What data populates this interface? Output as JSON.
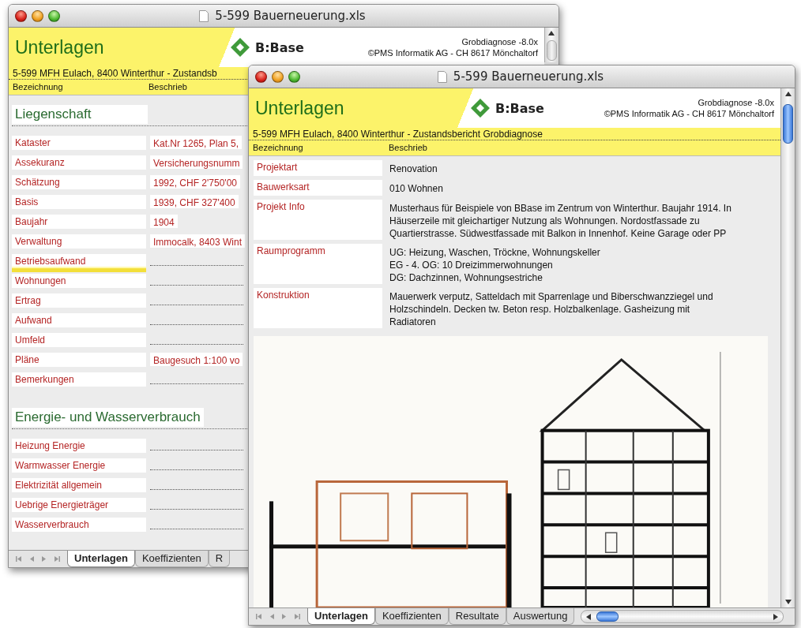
{
  "back_window": {
    "title": "5-599 Bauerneuerung.xls",
    "header": {
      "heading": "Unterlagen",
      "logo": "B:Base",
      "version": "Grobdiagnose -8.0x",
      "copyright": "©PMS Informatik AG  - CH 8617 Mönchaltorf",
      "subtitle": "5-599 MFH Eulach, 8400 Winterthur - Zustandsb"
    },
    "columns": [
      "Bezeichnung",
      "Beschrieb"
    ],
    "sections": [
      {
        "title": "Liegenschaft",
        "rows": [
          {
            "label": "Kataster",
            "value": "Kat.Nr 1265, Plan 5,",
            "highlighted": false
          },
          {
            "label": "Assekuranz",
            "value": "Versicherungsnumm",
            "highlighted": false
          },
          {
            "label": "Schätzung",
            "value": "1992, CHF 2'750'00",
            "highlighted": false
          },
          {
            "label": "Basis",
            "value": "1939, CHF 327'400",
            "highlighted": false
          },
          {
            "label": "Baujahr",
            "value": "1904",
            "highlighted": false
          },
          {
            "label": "Verwaltung",
            "value": "Immocalk, 8403 Wint",
            "highlighted": false
          },
          {
            "label": "Betriebsaufwand",
            "highlighted": true
          },
          {
            "label": "Wohnungen",
            "highlighted": false
          },
          {
            "label": "Ertrag",
            "highlighted": false
          },
          {
            "label": "Aufwand",
            "highlighted": false
          },
          {
            "label": "Umfeld",
            "highlighted": false
          },
          {
            "label": "Pläne",
            "value": "Baugesuch 1:100 vo",
            "highlighted": false
          },
          {
            "label": "Bemerkungen",
            "highlighted": false
          }
        ]
      },
      {
        "title": "Energie- und Wasserverbrauch",
        "rows": [
          {
            "label": "Heizung Energie",
            "highlighted": false
          },
          {
            "label": "Warmwasser Energie",
            "highlighted": false
          },
          {
            "label": "Elektrizität allgemein",
            "highlighted": false
          },
          {
            "label": "Uebrige Energieträger",
            "highlighted": false
          },
          {
            "label": "Wasserverbrauch",
            "highlighted": false
          }
        ]
      }
    ],
    "tabs": [
      {
        "label": "Unterlagen",
        "selected": true
      },
      {
        "label": "Koeffizienten",
        "selected": false
      },
      {
        "label": "R",
        "selected": false
      }
    ]
  },
  "front_window": {
    "title": "5-599 Bauerneuerung.xls",
    "header": {
      "heading": "Unterlagen",
      "logo": "B:Base",
      "version": "Grobdiagnose -8.0x",
      "copyright": "©PMS Informatik AG  - CH 8617 Mönchaltorf",
      "subtitle": "5-599 MFH Eulach, 8400 Winterthur - Zustandsbericht Grobdiagnose"
    },
    "columns": [
      "Bezeichnung",
      "Beschrieb"
    ],
    "rows": [
      {
        "label": "Projektart",
        "lines": [
          "Renovation"
        ]
      },
      {
        "label": "Bauwerksart",
        "lines": [
          "010 Wohnen"
        ]
      },
      {
        "label": "Projekt Info",
        "lines": [
          "Musterhaus für Beispiele von BBase im Zentrum von Winterthur. Baujahr 1914. In",
          "Häuserzeile mit gleichartiger Nutzung als Wohnungen. Nordostfassade zu",
          "Quartierstrasse. Südwestfassade mit Balkon in Innenhof. Keine Garage oder PP"
        ]
      },
      {
        "label": "Raumprogramm",
        "lines": [
          "UG: Heizung, Waschen, Tröckne, Wohnungskeller",
          "EG - 4. OG: 10 Dreizimmerwohnungen",
          "DG: Dachzinnen, Wohnungsestriche"
        ]
      },
      {
        "label": "Konstruktion",
        "lines": [
          "Mauerwerk verputz, Satteldach mit Sparrenlage und Biberschwanzziegel und",
          "Holzschindeln. Decken tw. Beton resp. Holzbalkenlage. Gasheizung mit",
          "Radiatoren"
        ]
      }
    ],
    "tabs": [
      {
        "label": "Unterlagen",
        "selected": true
      },
      {
        "label": "Koeffizienten",
        "selected": false
      },
      {
        "label": "Resultate",
        "selected": false
      },
      {
        "label": "Auswertung",
        "selected": false
      }
    ]
  }
}
